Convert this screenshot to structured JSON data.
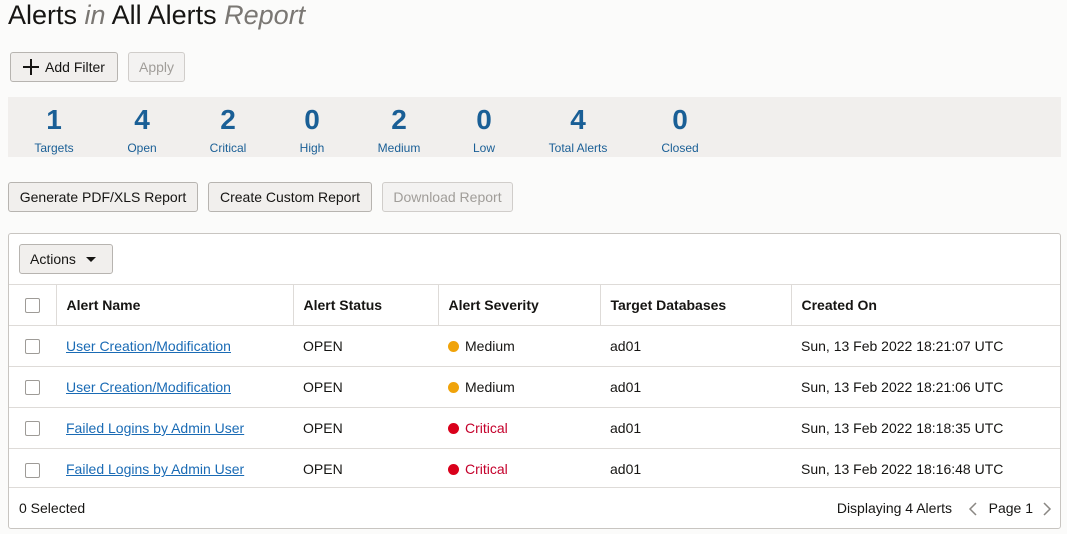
{
  "title": {
    "part1": "Alerts",
    "part2": "in",
    "part3": "All Alerts",
    "part4": "Report"
  },
  "toolbar": {
    "add_filter": "Add Filter",
    "apply": "Apply"
  },
  "stats": [
    {
      "value": "1",
      "label": "Targets"
    },
    {
      "value": "4",
      "label": "Open"
    },
    {
      "value": "2",
      "label": "Critical"
    },
    {
      "value": "0",
      "label": "High"
    },
    {
      "value": "2",
      "label": "Medium"
    },
    {
      "value": "0",
      "label": "Low"
    },
    {
      "value": "4",
      "label": "Total Alerts"
    },
    {
      "value": "0",
      "label": "Closed"
    }
  ],
  "report_buttons": {
    "generate": "Generate PDF/XLS Report",
    "custom": "Create Custom Report",
    "download": "Download Report"
  },
  "panel": {
    "actions": "Actions"
  },
  "table": {
    "headers": [
      "Alert Name",
      "Alert Status",
      "Alert Severity",
      "Target Databases",
      "Created On"
    ],
    "rows": [
      {
        "name": "User Creation/Modification",
        "status": "OPEN",
        "severity": "Medium",
        "target": "ad01",
        "created": "Sun, 13 Feb 2022 18:21:07 UTC"
      },
      {
        "name": "User Creation/Modification",
        "status": "OPEN",
        "severity": "Medium",
        "target": "ad01",
        "created": "Sun, 13 Feb 2022 18:21:06 UTC"
      },
      {
        "name": "Failed Logins by Admin User",
        "status": "OPEN",
        "severity": "Critical",
        "target": "ad01",
        "created": "Sun, 13 Feb 2022 18:18:35 UTC"
      },
      {
        "name": "Failed Logins by Admin User",
        "status": "OPEN",
        "severity": "Critical",
        "target": "ad01",
        "created": "Sun, 13 Feb 2022 18:16:48 UTC"
      }
    ]
  },
  "footer": {
    "selected": "0 Selected",
    "displaying": "Displaying 4 Alerts",
    "page": "Page 1"
  },
  "colors": {
    "medium": "#f0a30a",
    "critical": "#d9001b",
    "stat": "#1a5f96",
    "link": "#1a6bb5"
  }
}
